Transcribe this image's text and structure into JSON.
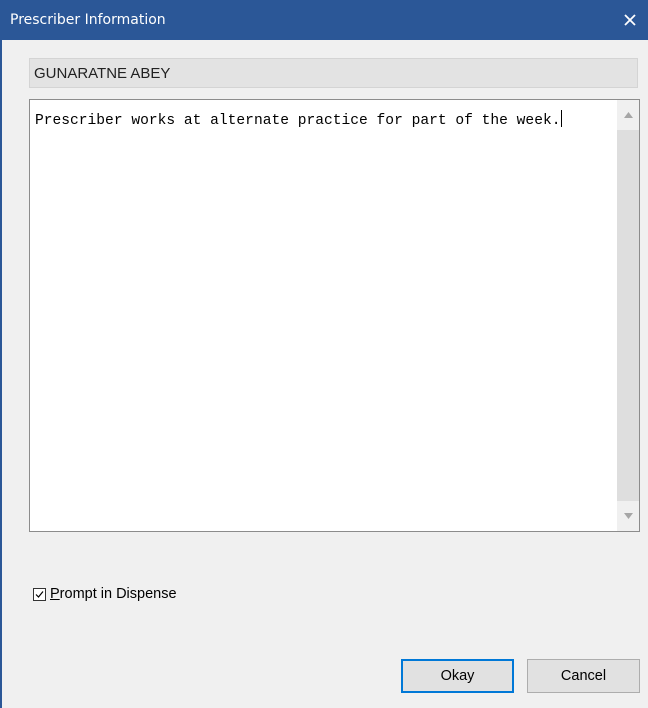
{
  "window": {
    "title": "Prescriber Information",
    "title_bar_color": "#2b5797"
  },
  "prescriber": {
    "name": "GUNARATNE ABEY"
  },
  "notes": {
    "text": "Prescriber works at alternate practice for part of the week."
  },
  "options": {
    "prompt_in_dispense": {
      "label_mnemonic": "P",
      "label_rest": "rompt in Dispense",
      "checked": true
    }
  },
  "buttons": {
    "okay": "Okay",
    "cancel": "Cancel"
  },
  "icons": {
    "close": "close-icon",
    "scroll_up": "scroll-up-arrow-icon",
    "scroll_down": "scroll-down-arrow-icon",
    "check": "checkmark-icon"
  }
}
